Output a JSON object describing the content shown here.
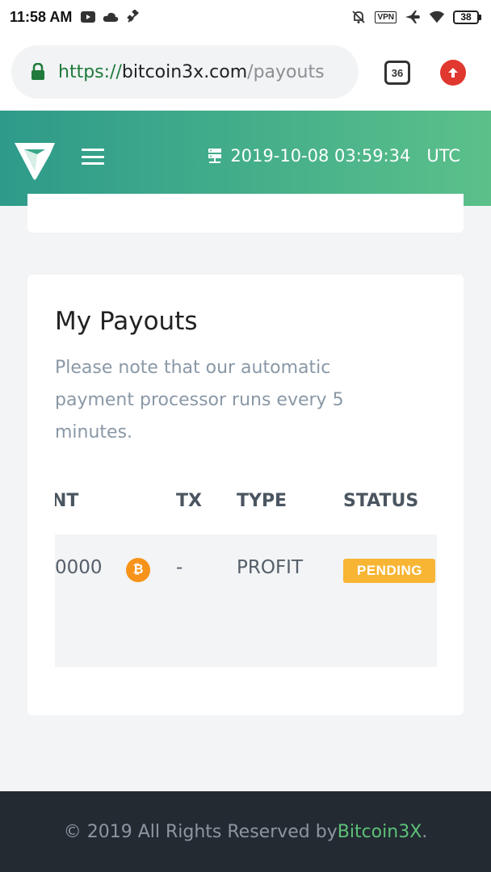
{
  "status_bar": {
    "time": "11:58 AM",
    "vpn_label": "VPN",
    "battery": "38",
    "icons": [
      "youtube-icon",
      "cloud-icon",
      "satellite-icon",
      "bell-off-icon",
      "vpn-icon",
      "airplane-icon",
      "wifi-icon",
      "battery-icon"
    ]
  },
  "browser": {
    "url_scheme": "https://",
    "url_host": "bitcoin3x.com",
    "url_path": "/payouts",
    "tab_count": "36",
    "icons": [
      "lock-icon",
      "upload-icon"
    ]
  },
  "header": {
    "server_time": "2019-10-08 03:59:34",
    "timezone": "UTC",
    "icons": [
      "logo-icon",
      "menu-icon",
      "server-icon"
    ]
  },
  "payouts": {
    "title": "My Payouts",
    "note": "Please note that our automatic payment processor runs every 5 minutes.",
    "columns": {
      "amount": "NT",
      "tx": "TX",
      "type": "TYPE",
      "status": "STATUS"
    },
    "rows": [
      {
        "amount": "0000",
        "currency_icon": "bitcoin-icon",
        "tx": "-",
        "type": "PROFIT",
        "status": "PENDING"
      }
    ]
  },
  "colors": {
    "header_gradient_start": "#2e9a8a",
    "header_gradient_end": "#5bc08a",
    "pending_badge": "#f7b533",
    "footer_bg": "#232a32",
    "brand_link": "#5cc177",
    "bitcoin": "#f7931a"
  },
  "footer": {
    "copyright": "© 2019 All Rights Reserved by ",
    "brand": "Bitcoin3X",
    "suffix": "."
  }
}
